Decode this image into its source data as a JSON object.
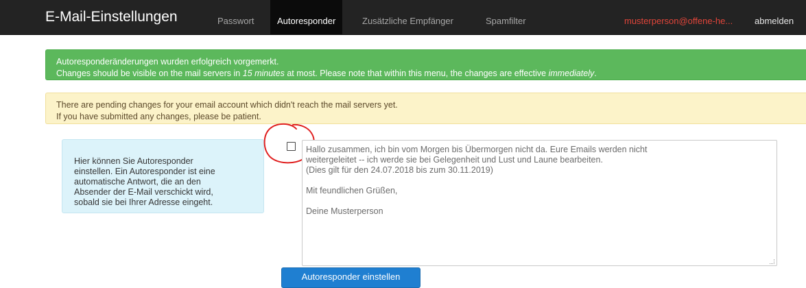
{
  "navbar": {
    "brand": "E-Mail-Einstellungen",
    "items": [
      {
        "label": "Passwort"
      },
      {
        "label": "Autoresponder"
      },
      {
        "label": "Zusätzliche Empfänger"
      },
      {
        "label": "Spamfilter"
      }
    ],
    "user": "musterperson@offene-he...",
    "logout": "abmelden"
  },
  "alerts": {
    "success": {
      "line1": "Autoresponderänderungen wurden erfolgreich vorgemerkt.",
      "line2_a": "Changes should be visible on the mail servers in ",
      "line2_em1": "15 minutes",
      "line2_b": " at most. Please note that within this menu, the changes are effective ",
      "line2_em2": "immediately",
      "line2_c": "."
    },
    "warning": {
      "line1": "There are pending changes for your email account which didn't reach the mail servers yet.",
      "line2": "If you have submitted any changes, please be patient."
    }
  },
  "info": {
    "lines": [
      "Hier können Sie Autoresponder",
      "einstellen. Ein Autoresponder ist eine",
      "automatische Antwort, die an den",
      "Absender der E-Mail verschickt wird,",
      "sobald sie bei Ihrer Adresse eingeht."
    ]
  },
  "autoresponder": {
    "enabled": false,
    "message_lines": [
      "Hallo zusammen, ich bin vom Morgen bis Übermorgen nicht da. Eure Emails werden nicht",
      "weitergeleitet -- ich werde sie bei Gelegenheit und Lust und Laune bearbeiten.",
      "(Dies gilt für den 24.07.2018 bis zum 30.11.2019)",
      "",
      "Mit feundlichen Grüßen,",
      "",
      "Deine Musterperson"
    ],
    "submit_label": "Autoresponder einstellen"
  },
  "colors": {
    "navbar_bg": "#232323",
    "success_bg": "#5cb85c",
    "warning_bg": "#fcf3c9",
    "info_bg": "#dcf3fa",
    "button_bg": "#1f7fd1",
    "user_text": "#e2453a",
    "annotation_circle": "#e02020"
  }
}
